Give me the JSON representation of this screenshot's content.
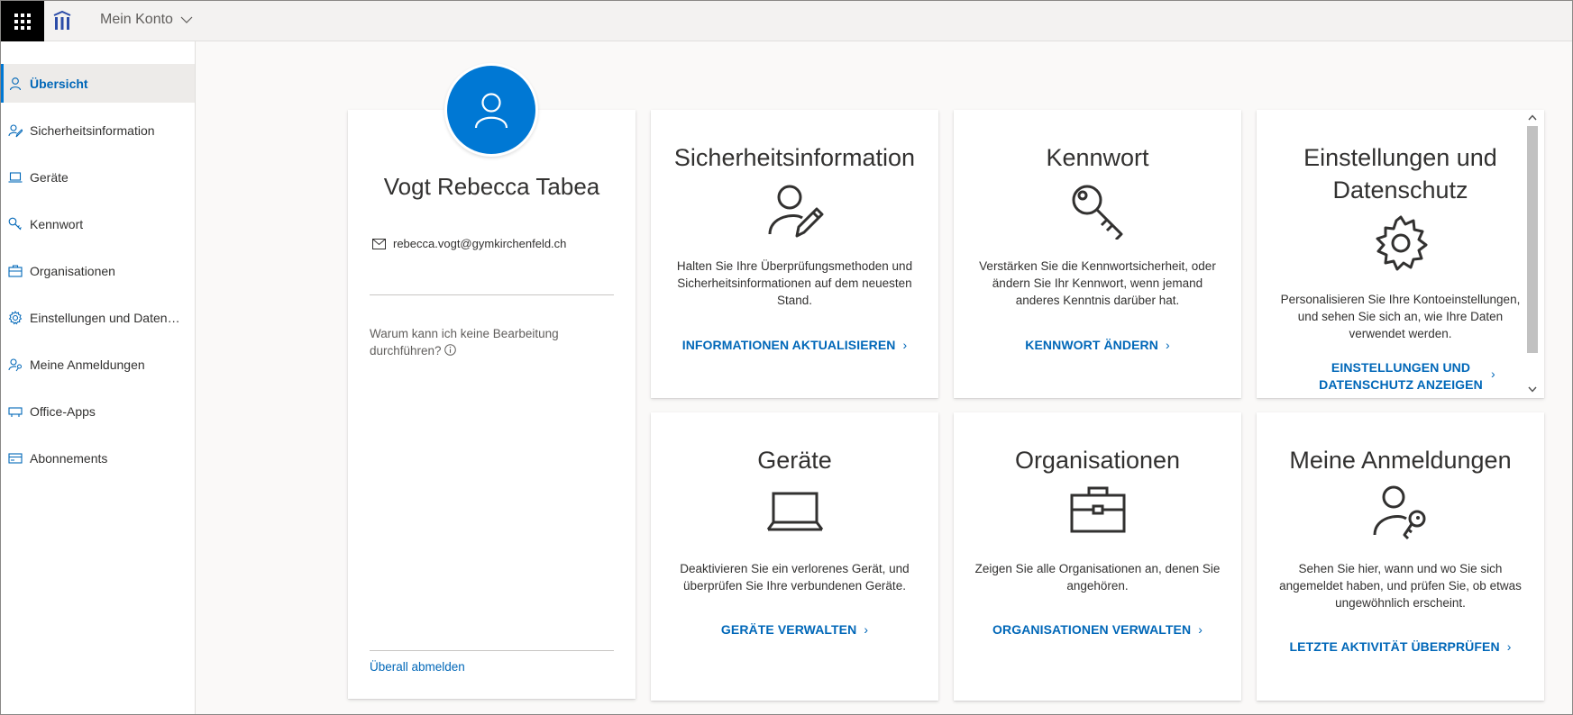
{
  "header": {
    "app_title": "Mein Konto"
  },
  "sidebar": {
    "items": [
      {
        "label": "Übersicht",
        "icon": "person-icon",
        "active": true
      },
      {
        "label": "Sicherheitsinformation",
        "icon": "person-edit-icon"
      },
      {
        "label": "Geräte",
        "icon": "laptop-icon"
      },
      {
        "label": "Kennwort",
        "icon": "key-icon"
      },
      {
        "label": "Organisationen",
        "icon": "briefcase-icon"
      },
      {
        "label": "Einstellungen und Datenschutz",
        "icon": "gear-icon"
      },
      {
        "label": "Meine Anmeldungen",
        "icon": "person-key-icon"
      },
      {
        "label": "Office-Apps",
        "icon": "apps-icon"
      },
      {
        "label": "Abonnements",
        "icon": "credit-card-icon"
      }
    ]
  },
  "profile": {
    "name": "Vogt Rebecca Tabea",
    "email": "rebecca.vogt@gymkirchenfeld.ch",
    "why_cannot_edit": "Warum kann ich keine Bearbeitung durchführen?",
    "signout_everywhere": "Überall abmelden"
  },
  "tiles": {
    "security": {
      "title": "Sicherheitsinformation",
      "description": "Halten Sie Ihre Überprüfungsmethoden und Sicherheitsinformationen auf dem neuesten Stand.",
      "link": "INFORMATIONEN AKTUALISIEREN"
    },
    "password": {
      "title": "Kennwort",
      "description": "Verstärken Sie die Kennwortsicherheit, oder ändern Sie Ihr Kennwort, wenn jemand anderes Kenntnis darüber hat.",
      "link": "KENNWORT ÄNDERN"
    },
    "settings": {
      "title": "Einstellungen und Datenschutz",
      "description": "Personalisieren Sie Ihre Kontoeinstellungen, und sehen Sie sich an, wie Ihre Daten verwendet werden.",
      "link": "EINSTELLUNGEN UND DATENSCHUTZ ANZEIGEN"
    },
    "devices": {
      "title": "Geräte",
      "description": "Deaktivieren Sie ein verlorenes Gerät, und überprüfen Sie Ihre verbundenen Geräte.",
      "link": "GERÄTE VERWALTEN"
    },
    "organizations": {
      "title": "Organisationen",
      "description": "Zeigen Sie alle Organisationen an, denen Sie angehören.",
      "link": "ORGANISATIONEN VERWALTEN"
    },
    "signins": {
      "title": "Meine Anmeldungen",
      "description": "Sehen Sie hier, wann und wo Sie sich angemeldet haben, und prüfen Sie, ob etwas ungewöhnlich erscheint.",
      "link": "LETZTE AKTIVITÄT ÜBERPRÜFEN"
    }
  },
  "colors": {
    "accent": "#0078d4",
    "link": "#0067b8",
    "text": "#323130"
  }
}
